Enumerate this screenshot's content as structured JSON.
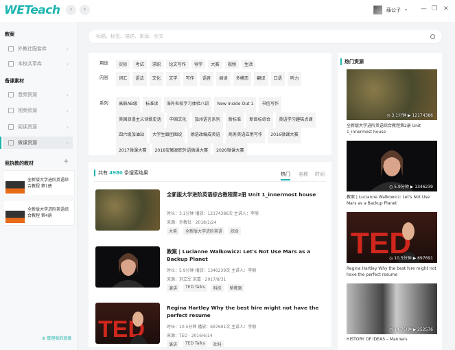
{
  "app": {
    "logo": "WETeach",
    "user": "薛公子"
  },
  "search": {
    "placeholder": "标题、标签、描述、来源、全文"
  },
  "sidebar": {
    "sec1": "教案",
    "sec1_items": [
      "外教社配套库",
      "本校共享库"
    ],
    "sec2": "备课素材",
    "sec2_items": [
      "音频资源",
      "视频资源",
      "阅读资源",
      "微课资源"
    ],
    "sec3": "我执教的教材",
    "books": [
      {
        "title1": "全新版大学进阶英语综",
        "title2": "合教程 第1册"
      },
      {
        "title1": "全新版大学进阶英语综",
        "title2": "合教程 第4册"
      }
    ],
    "manage": "管理我的班级"
  },
  "filters": {
    "yongtu": {
      "label": "用途",
      "chips": [
        "实际",
        "考试",
        "求职",
        "论文写作",
        "导学",
        "大赛",
        "视频",
        "生活"
      ]
    },
    "neirong": {
      "label": "内容",
      "chips": [
        "词汇",
        "语法",
        "文化",
        "文学",
        "写作",
        "语音",
        "阅读",
        "多模态",
        "翻译",
        "口语",
        "听力"
      ]
    },
    "xilie": {
      "label": "系列",
      "chips": [
        "高职AB级",
        "标准读",
        "海外名校学习体验八讲",
        "New Inside Out 1",
        "书信写作",
        "英国浪漫主义诗歌史话",
        "中国文化",
        "加州语言系列",
        "新标准",
        "新目标综合",
        "英语学习趣味点滴",
        "四六级加油站",
        "大学生跟团图说",
        "德语改编成英语",
        "商务英语应用写作",
        "2016微课大赛",
        "2017微课大赛",
        "2018安徽高职外语微课大赛",
        "2020微课大赛"
      ]
    }
  },
  "results": {
    "count_prefix": "共有",
    "count": "4980",
    "count_suffix": "条搜索结果",
    "sort": [
      "热门",
      "名称",
      "时间"
    ],
    "items": [
      {
        "title": "全新版大学进阶英语综合教程第2册 Unit 1_innermost house",
        "meta1": "时长：3.1分钟   播放：12174386次   主讲人：李丽",
        "meta2": "来源：外教社 · 2018/1/24",
        "tags": [
          "大英",
          "全新版大学进阶英语",
          "综合"
        ]
      },
      {
        "title": "教案 | Lucianne Walkowicz: Let's Not Use Mars as a Backup Planet",
        "meta1": "时长：5.9分钟   播放：1346239次   主讲人：李丽",
        "meta2": "来源：刘立军 宋嘉 · 2017/8/31",
        "tags": [
          "演讲",
          "TED Talks",
          "科技",
          "帮教案"
        ]
      },
      {
        "title": "Regina Hartley Why the best hire might not have the perfect resume",
        "meta1": "时长：10.5分钟   播放：697691次   主讲人：李丽",
        "meta2": "来源：TED · 2016/6/14",
        "tags": [
          "演讲",
          "TED Talks",
          "社科"
        ]
      }
    ]
  },
  "hot": {
    "title": "热门资源",
    "items": [
      {
        "duration": "3.1分钟",
        "plays": "12174386",
        "title": "全新版大学进阶英语综合教程第2册 Unit 1_innermost house"
      },
      {
        "duration": "5.9分钟",
        "plays": "1346239",
        "title": "教案 | Lucianne Walkowicz: Let's Not Use Mars as a Backup Planet"
      },
      {
        "duration": "10.5分钟",
        "plays": "697691",
        "title": "Regina Hartley Why the best hire might not have the perfect resume"
      },
      {
        "duration": "14.7分钟",
        "plays": "252576",
        "title": "HISTORY OF IDEAS – Manners"
      }
    ]
  },
  "colors": {
    "accent": "#1eb5b0"
  }
}
